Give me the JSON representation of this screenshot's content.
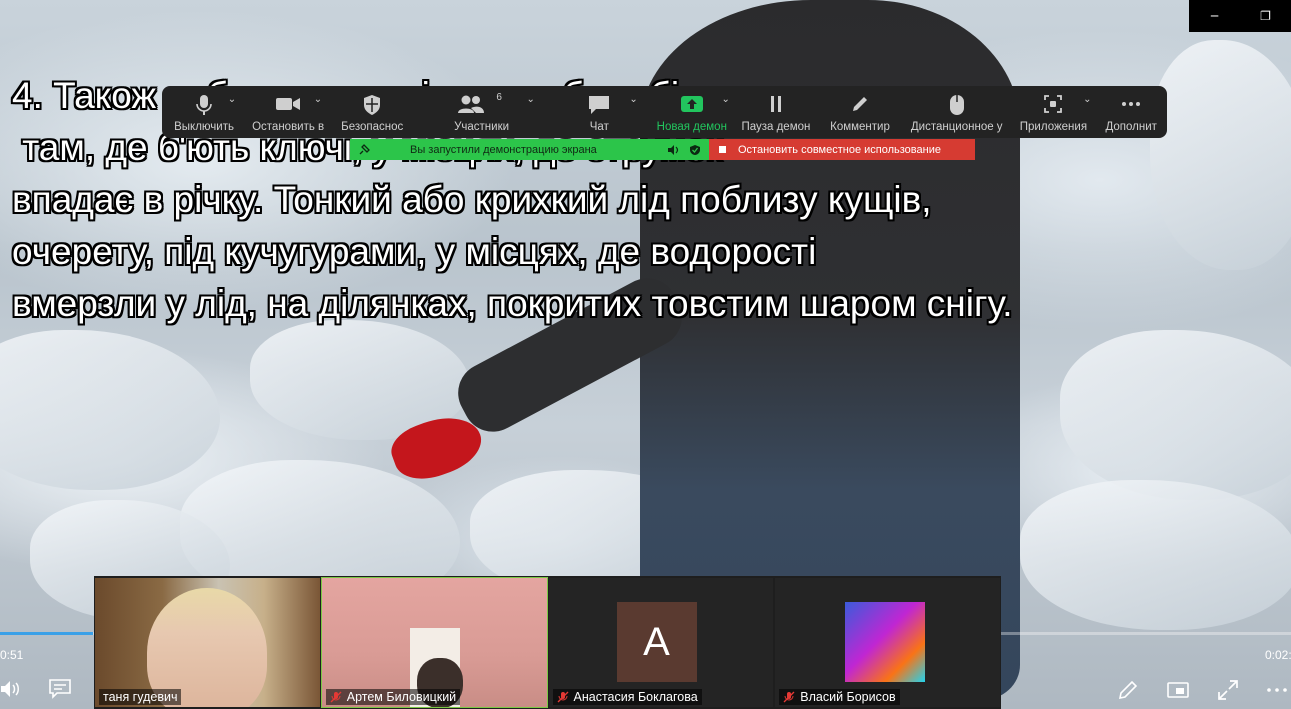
{
  "window": {
    "minimize_icon": "minimize-icon",
    "restore_icon": "restore-icon",
    "minimize_glyph": "─",
    "restore_glyph": "❐"
  },
  "slide": {
    "lines": [
      "4. Також небезпечним лід може бути біля стоку води",
      " там, де б'ють ключі, у місцях, де струмок",
      "впадає в річку. Тонкий або крихкий лід поблизу кущів,",
      "очерету, під кучугурами, у місцях, де водорості",
      "вмерзли у лід, на ділянках, покритих товстим шаром снігу."
    ]
  },
  "toolbar": {
    "items": [
      {
        "label": "Выключить",
        "icon": "microphone-icon",
        "caret": true
      },
      {
        "label": "Остановить в",
        "icon": "video-camera-icon",
        "caret": true
      },
      {
        "label": "Безопаснос",
        "icon": "shield-icon",
        "caret": false
      },
      {
        "label": "Участники",
        "icon": "participants-icon",
        "caret": true,
        "count": "6"
      },
      {
        "label": "Чат",
        "icon": "chat-icon",
        "caret": true
      },
      {
        "label": "Новая демон",
        "icon": "share-screen-icon",
        "caret": true,
        "active": true
      },
      {
        "label": "Пауза демон",
        "icon": "pause-icon",
        "caret": false
      },
      {
        "label": "Комментир",
        "icon": "pen-icon",
        "caret": false
      },
      {
        "label": "Дистанционное у",
        "icon": "mouse-icon",
        "caret": false
      },
      {
        "label": "Приложения",
        "icon": "apps-icon",
        "caret": true
      },
      {
        "label": "Дополнит",
        "icon": "more-icon",
        "caret": false
      }
    ],
    "accent": "#22c55e"
  },
  "share_banner": {
    "status": "Вы запустили демонстрацию экрана",
    "stop": "Остановить совместное использование",
    "green": "#2cc54a",
    "red": "#d63b32"
  },
  "player": {
    "time_current": "0:51",
    "time_total": "0:02:",
    "progress": 0.072,
    "progress_color": "#3aa0e8"
  },
  "participants": [
    {
      "name": "таня гудевич",
      "muted": false,
      "speaking": false,
      "type": "video"
    },
    {
      "name": "Артем Биловицкий",
      "muted": true,
      "speaking": true,
      "type": "video"
    },
    {
      "name": "Анастасия Боклагова",
      "muted": true,
      "speaking": false,
      "type": "initial",
      "initial": "A"
    },
    {
      "name": "Власий Борисов",
      "muted": true,
      "speaking": false,
      "type": "image"
    }
  ]
}
